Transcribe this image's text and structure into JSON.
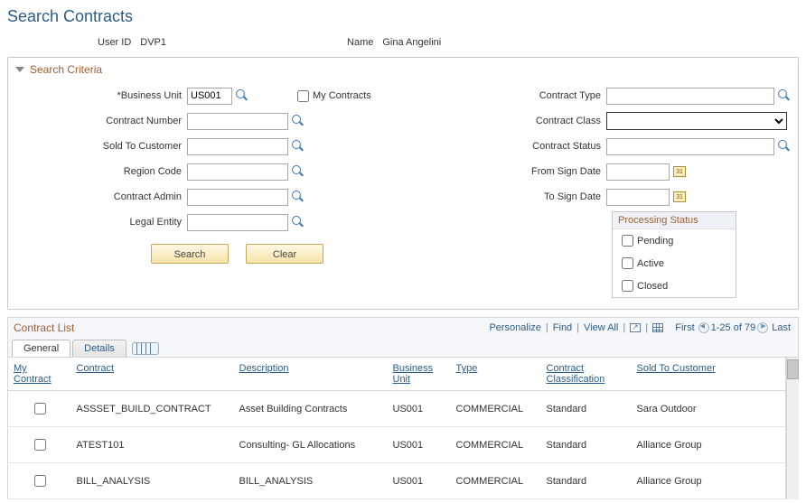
{
  "page_title": "Search Contracts",
  "user": {
    "id_label": "User ID",
    "id_value": "DVP1",
    "name_label": "Name",
    "name_value": "Gina Angelini"
  },
  "criteria": {
    "header": "Search Criteria",
    "business_unit_label": "Business Unit",
    "business_unit_value": "US001",
    "my_contracts_label": "My Contracts",
    "contract_number_label": "Contract Number",
    "sold_to_label": "Sold To Customer",
    "region_label": "Region Code",
    "admin_label": "Contract Admin",
    "legal_label": "Legal Entity",
    "contract_type_label": "Contract Type",
    "contract_class_label": "Contract Class",
    "contract_status_label": "Contract Status",
    "from_sign_label": "From Sign Date",
    "to_sign_label": "To Sign Date",
    "proc_status_legend": "Processing Status",
    "proc_status": {
      "pending": "Pending",
      "active": "Active",
      "closed": "Closed"
    },
    "search_btn": "Search",
    "clear_btn": "Clear"
  },
  "list": {
    "title": "Contract List",
    "tools": {
      "personalize": "Personalize",
      "find": "Find",
      "view_all": "View All",
      "first": "First",
      "range": "1-25 of 79",
      "last": "Last"
    },
    "tabs": {
      "general": "General",
      "details": "Details"
    },
    "columns": {
      "my_contract": "My Contract",
      "contract": "Contract",
      "description": "Description",
      "bu": "Business Unit",
      "type": "Type",
      "classification": "Contract Classification",
      "sold_to": "Sold To Customer"
    },
    "rows": [
      {
        "contract": "ASSSET_BUILD_CONTRACT",
        "description": "Asset Building Contracts",
        "bu": "US001",
        "type": "COMMERCIAL",
        "classification": "Standard",
        "sold_to": "Sara Outdoor"
      },
      {
        "contract": "ATEST101",
        "description": "Consulting- GL Allocations",
        "bu": "US001",
        "type": "COMMERCIAL",
        "classification": "Standard",
        "sold_to": "Alliance Group"
      },
      {
        "contract": "BILL_ANALYSIS",
        "description": "BILL_ANALYSIS",
        "bu": "US001",
        "type": "COMMERCIAL",
        "classification": "Standard",
        "sold_to": "Alliance Group"
      }
    ]
  },
  "cal_text": "31"
}
